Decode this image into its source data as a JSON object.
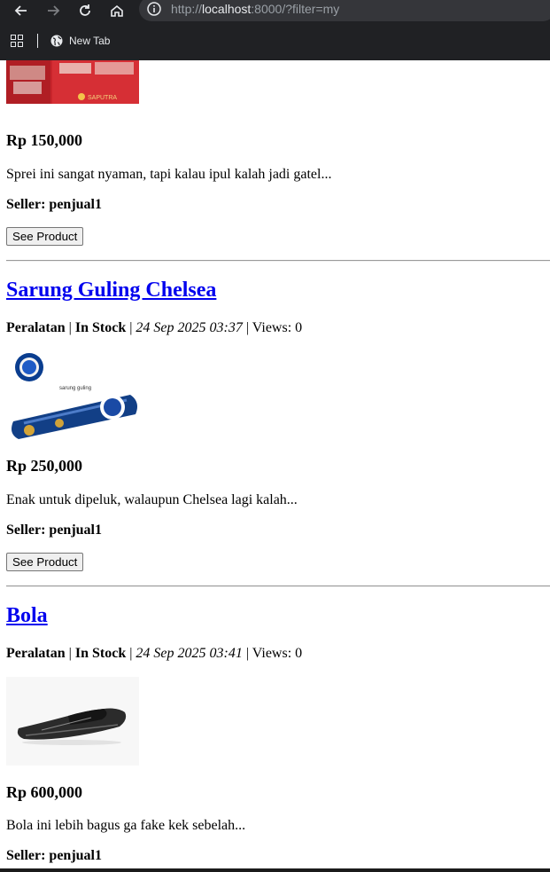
{
  "browser": {
    "url_scheme": "http://",
    "url_host": "localhost",
    "url_rest": ":8000/?filter=my",
    "bookmark_new_tab": "New Tab"
  },
  "products": [
    {
      "price": "Rp 150,000",
      "description": "Sprei ini sangat nyaman, tapi kalau ipul kalah jadi gatel...",
      "seller": "Seller: penjual1",
      "button": "See Product",
      "image_text": "SAPUTRA"
    },
    {
      "name": "Sarung Guling Chelsea",
      "category": "Peralatan",
      "stock": "In Stock",
      "date": "24 Sep 2025 03:37",
      "views": "Views: 0",
      "price": "Rp 250,000",
      "description": "Enak untuk dipeluk, walaupun Chelsea lagi kalah...",
      "seller": "Seller: penjual1",
      "button": "See Product",
      "image_text": "sarung guling"
    },
    {
      "name": "Bola",
      "category": "Peralatan",
      "stock": "In Stock",
      "date": "24 Sep 2025 03:41",
      "views": "Views: 0",
      "price": "Rp 600,000",
      "description": "Bola ini lebih bagus ga fake kek sebelah...",
      "seller": "Seller: penjual1"
    }
  ],
  "colors": {
    "chrome_bg": "#202124",
    "link": "#0000ee"
  }
}
